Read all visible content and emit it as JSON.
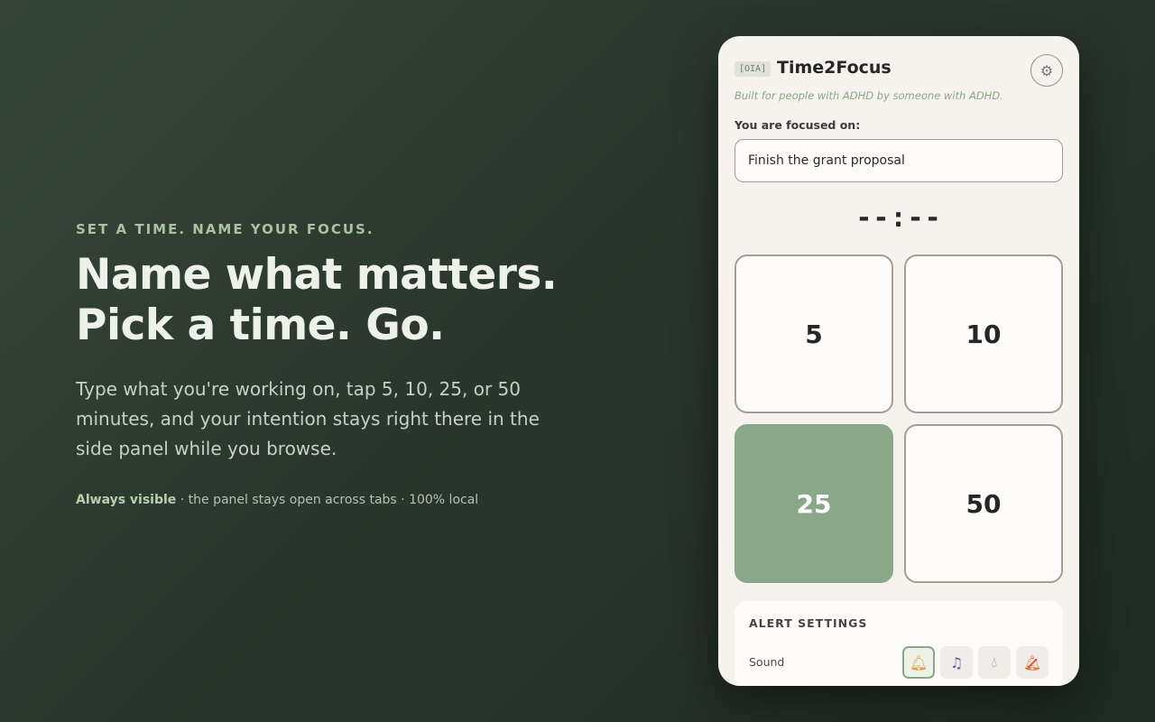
{
  "hero": {
    "eyebrow": "SET A TIME. NAME YOUR FOCUS.",
    "headline": "Name what matters. Pick a time. Go.",
    "subtext": "Type what you're working on, tap 5, 10, 25, or 50 minutes, and your intention stays right there in the side panel while you browse.",
    "features_strong": "Always visible",
    "features_rest": " · the panel stays open across tabs · 100% local"
  },
  "panel": {
    "tag": "[OIA]",
    "title": "Time2Focus",
    "settings_icon": "gear-icon",
    "tagline": "Built for people with ADHD by someone with ADHD.",
    "focus_label": "You are focused on:",
    "focus_value": "Finish the grant proposal",
    "timer": "--:--",
    "presets": [
      "5",
      "10",
      "25",
      "50"
    ],
    "active_preset": "25",
    "alerts": {
      "title": "ALERT SETTINGS",
      "sound_label": "Sound",
      "sound_options": [
        "bell-icon",
        "music-note-icon",
        "droplet-icon",
        "mute-icon"
      ],
      "selected_sound": "bell-icon"
    }
  },
  "colors": {
    "accent": "#8aa888",
    "background": "#2c3a31",
    "panel": "#f6f3ee"
  }
}
